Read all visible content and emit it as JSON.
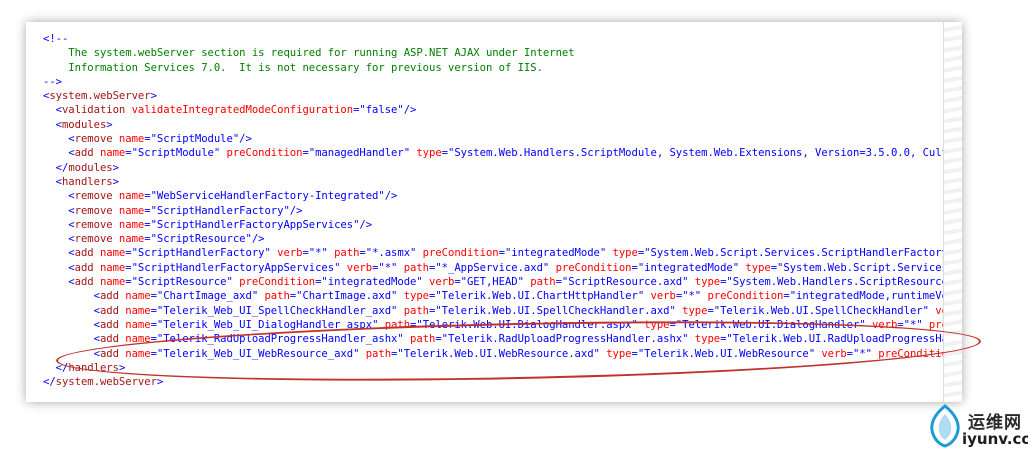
{
  "lines": [
    [
      {
        "c": "b",
        "t": "<!--"
      }
    ],
    [
      {
        "c": "c",
        "t": "    The system.webServer section is required for running ASP.NET AJAX under Internet"
      }
    ],
    [
      {
        "c": "c",
        "t": "    Information Services 7.0.  It is not necessary for previous version of IIS."
      }
    ],
    [
      {
        "c": "b",
        "t": "-->"
      }
    ],
    [
      {
        "c": "b",
        "t": "<"
      },
      {
        "c": "t",
        "t": "system.webServer"
      },
      {
        "c": "b",
        "t": ">"
      }
    ],
    [
      {
        "c": "b",
        "t": "  <"
      },
      {
        "c": "t",
        "t": "validation"
      },
      {
        "c": "a",
        "t": " validateIntegratedModeConfiguration"
      },
      {
        "c": "b",
        "t": "=\""
      },
      {
        "c": "v",
        "t": "false"
      },
      {
        "c": "b",
        "t": "\"/>"
      }
    ],
    [
      {
        "c": "b",
        "t": "  <"
      },
      {
        "c": "t",
        "t": "modules"
      },
      {
        "c": "b",
        "t": ">"
      }
    ],
    [
      {
        "c": "b",
        "t": "    <"
      },
      {
        "c": "t",
        "t": "remove"
      },
      {
        "c": "a",
        "t": " name"
      },
      {
        "c": "b",
        "t": "=\""
      },
      {
        "c": "v",
        "t": "ScriptModule"
      },
      {
        "c": "b",
        "t": "\"/>"
      }
    ],
    [
      {
        "c": "b",
        "t": "    <"
      },
      {
        "c": "t",
        "t": "add"
      },
      {
        "c": "a",
        "t": " name"
      },
      {
        "c": "b",
        "t": "=\""
      },
      {
        "c": "v",
        "t": "ScriptModule"
      },
      {
        "c": "b",
        "t": "\""
      },
      {
        "c": "a",
        "t": " preCondition"
      },
      {
        "c": "b",
        "t": "=\""
      },
      {
        "c": "v",
        "t": "managedHandler"
      },
      {
        "c": "b",
        "t": "\""
      },
      {
        "c": "a",
        "t": " type"
      },
      {
        "c": "b",
        "t": "=\""
      },
      {
        "c": "v",
        "t": "System.Web.Handlers.ScriptModule, System.Web.Extensions, Version=3.5.0.0, Culture"
      }
    ],
    [
      {
        "c": "b",
        "t": "  </"
      },
      {
        "c": "t",
        "t": "modules"
      },
      {
        "c": "b",
        "t": ">"
      }
    ],
    [
      {
        "c": "b",
        "t": "  <"
      },
      {
        "c": "t",
        "t": "handlers"
      },
      {
        "c": "b",
        "t": ">"
      }
    ],
    [
      {
        "c": "b",
        "t": "    <"
      },
      {
        "c": "t",
        "t": "remove"
      },
      {
        "c": "a",
        "t": " name"
      },
      {
        "c": "b",
        "t": "=\""
      },
      {
        "c": "v",
        "t": "WebServiceHandlerFactory-Integrated"
      },
      {
        "c": "b",
        "t": "\"/>"
      }
    ],
    [
      {
        "c": "b",
        "t": "    <"
      },
      {
        "c": "t",
        "t": "remove"
      },
      {
        "c": "a",
        "t": " name"
      },
      {
        "c": "b",
        "t": "=\""
      },
      {
        "c": "v",
        "t": "ScriptHandlerFactory"
      },
      {
        "c": "b",
        "t": "\"/>"
      }
    ],
    [
      {
        "c": "b",
        "t": "    <"
      },
      {
        "c": "t",
        "t": "remove"
      },
      {
        "c": "a",
        "t": " name"
      },
      {
        "c": "b",
        "t": "=\""
      },
      {
        "c": "v",
        "t": "ScriptHandlerFactoryAppServices"
      },
      {
        "c": "b",
        "t": "\"/>"
      }
    ],
    [
      {
        "c": "b",
        "t": "    <"
      },
      {
        "c": "t",
        "t": "remove"
      },
      {
        "c": "a",
        "t": " name"
      },
      {
        "c": "b",
        "t": "=\""
      },
      {
        "c": "v",
        "t": "ScriptResource"
      },
      {
        "c": "b",
        "t": "\"/>"
      }
    ],
    [
      {
        "c": "b",
        "t": "    <"
      },
      {
        "c": "t",
        "t": "add"
      },
      {
        "c": "a",
        "t": " name"
      },
      {
        "c": "b",
        "t": "=\""
      },
      {
        "c": "v",
        "t": "ScriptHandlerFactory"
      },
      {
        "c": "b",
        "t": "\""
      },
      {
        "c": "a",
        "t": " verb"
      },
      {
        "c": "b",
        "t": "=\""
      },
      {
        "c": "v",
        "t": "*"
      },
      {
        "c": "b",
        "t": "\""
      },
      {
        "c": "a",
        "t": " path"
      },
      {
        "c": "b",
        "t": "=\""
      },
      {
        "c": "v",
        "t": "*.asmx"
      },
      {
        "c": "b",
        "t": "\""
      },
      {
        "c": "a",
        "t": " preCondition"
      },
      {
        "c": "b",
        "t": "=\""
      },
      {
        "c": "v",
        "t": "integratedMode"
      },
      {
        "c": "b",
        "t": "\""
      },
      {
        "c": "a",
        "t": " type"
      },
      {
        "c": "b",
        "t": "=\""
      },
      {
        "c": "v",
        "t": "System.Web.Script.Services.ScriptHandlerFactory, S"
      }
    ],
    [
      {
        "c": "b",
        "t": "    <"
      },
      {
        "c": "t",
        "t": "add"
      },
      {
        "c": "a",
        "t": " name"
      },
      {
        "c": "b",
        "t": "=\""
      },
      {
        "c": "v",
        "t": "ScriptHandlerFactoryAppServices"
      },
      {
        "c": "b",
        "t": "\""
      },
      {
        "c": "a",
        "t": " verb"
      },
      {
        "c": "b",
        "t": "=\""
      },
      {
        "c": "v",
        "t": "*"
      },
      {
        "c": "b",
        "t": "\""
      },
      {
        "c": "a",
        "t": " path"
      },
      {
        "c": "b",
        "t": "=\""
      },
      {
        "c": "v",
        "t": "*_AppService.axd"
      },
      {
        "c": "b",
        "t": "\""
      },
      {
        "c": "a",
        "t": " preCondition"
      },
      {
        "c": "b",
        "t": "=\""
      },
      {
        "c": "v",
        "t": "integratedMode"
      },
      {
        "c": "b",
        "t": "\""
      },
      {
        "c": "a",
        "t": " type"
      },
      {
        "c": "b",
        "t": "=\""
      },
      {
        "c": "v",
        "t": "System.Web.Script.Services.Sc"
      }
    ],
    [
      {
        "c": "b",
        "t": "    <"
      },
      {
        "c": "t",
        "t": "add"
      },
      {
        "c": "a",
        "t": " name"
      },
      {
        "c": "b",
        "t": "=\""
      },
      {
        "c": "v",
        "t": "ScriptResource"
      },
      {
        "c": "b",
        "t": "\""
      },
      {
        "c": "a",
        "t": " preCondition"
      },
      {
        "c": "b",
        "t": "=\""
      },
      {
        "c": "v",
        "t": "integratedMode"
      },
      {
        "c": "b",
        "t": "\""
      },
      {
        "c": "a",
        "t": " verb"
      },
      {
        "c": "b",
        "t": "=\""
      },
      {
        "c": "v",
        "t": "GET,HEAD"
      },
      {
        "c": "b",
        "t": "\""
      },
      {
        "c": "a",
        "t": " path"
      },
      {
        "c": "b",
        "t": "=\""
      },
      {
        "c": "v",
        "t": "ScriptResource.axd"
      },
      {
        "c": "b",
        "t": "\""
      },
      {
        "c": "a",
        "t": " type"
      },
      {
        "c": "b",
        "t": "=\""
      },
      {
        "c": "v",
        "t": "System.Web.Handlers.ScriptResourceHan"
      }
    ],
    [
      {
        "c": "b",
        "t": "        <"
      },
      {
        "c": "t",
        "t": "add"
      },
      {
        "c": "a",
        "t": " name"
      },
      {
        "c": "b",
        "t": "=\""
      },
      {
        "c": "v",
        "t": "ChartImage_axd"
      },
      {
        "c": "b",
        "t": "\""
      },
      {
        "c": "a",
        "t": " path"
      },
      {
        "c": "b",
        "t": "=\""
      },
      {
        "c": "v",
        "t": "ChartImage.axd"
      },
      {
        "c": "b",
        "t": "\""
      },
      {
        "c": "a",
        "t": " type"
      },
      {
        "c": "b",
        "t": "=\""
      },
      {
        "c": "v",
        "t": "Telerik.Web.UI.ChartHttpHandler"
      },
      {
        "c": "b",
        "t": "\""
      },
      {
        "c": "a",
        "t": " verb"
      },
      {
        "c": "b",
        "t": "=\""
      },
      {
        "c": "v",
        "t": "*"
      },
      {
        "c": "b",
        "t": "\""
      },
      {
        "c": "a",
        "t": " preCondition"
      },
      {
        "c": "b",
        "t": "=\""
      },
      {
        "c": "v",
        "t": "integratedMode,runtimeVersi"
      }
    ],
    [
      {
        "c": "b",
        "t": "        <"
      },
      {
        "c": "t",
        "t": "add"
      },
      {
        "c": "a",
        "t": " name"
      },
      {
        "c": "b",
        "t": "=\""
      },
      {
        "c": "v",
        "t": "Telerik_Web_UI_SpellCheckHandler_axd"
      },
      {
        "c": "b",
        "t": "\""
      },
      {
        "c": "a",
        "t": " path"
      },
      {
        "c": "b",
        "t": "=\""
      },
      {
        "c": "v",
        "t": "Telerik.Web.UI.SpellCheckHandler.axd"
      },
      {
        "c": "b",
        "t": "\""
      },
      {
        "c": "a",
        "t": " type"
      },
      {
        "c": "b",
        "t": "=\""
      },
      {
        "c": "v",
        "t": "Telerik.Web.UI.SpellCheckHandler"
      },
      {
        "c": "b",
        "t": "\""
      },
      {
        "c": "a",
        "t": " verb"
      },
      {
        "c": "b",
        "t": "="
      }
    ],
    [
      {
        "c": "b",
        "t": "        <"
      },
      {
        "c": "t",
        "t": "add"
      },
      {
        "c": "a",
        "t": " name"
      },
      {
        "c": "b",
        "t": "=\""
      },
      {
        "c": "v",
        "t": "Telerik_Web_UI_DialogHandler_aspx"
      },
      {
        "c": "b",
        "t": "\""
      },
      {
        "c": "a",
        "t": " path"
      },
      {
        "c": "b",
        "t": "=\""
      },
      {
        "c": "v",
        "t": "Telerik.Web.UI.DialogHandler.aspx"
      },
      {
        "c": "b",
        "t": "\""
      },
      {
        "c": "a",
        "t": " type"
      },
      {
        "c": "b",
        "t": "=\""
      },
      {
        "c": "v",
        "t": "Telerik.Web.UI.DialogHandler"
      },
      {
        "c": "b",
        "t": "\""
      },
      {
        "c": "a",
        "t": " verb"
      },
      {
        "c": "b",
        "t": "=\""
      },
      {
        "c": "v",
        "t": "*"
      },
      {
        "c": "b",
        "t": "\""
      },
      {
        "c": "a",
        "t": " preCon"
      }
    ],
    [
      {
        "c": "b",
        "t": "        <"
      },
      {
        "c": "t",
        "t": "add"
      },
      {
        "c": "a",
        "t": " name"
      },
      {
        "c": "b",
        "t": "=\""
      },
      {
        "c": "v",
        "t": "Telerik_RadUploadProgressHandler_ashx"
      },
      {
        "c": "b",
        "t": "\""
      },
      {
        "c": "a",
        "t": " path"
      },
      {
        "c": "b",
        "t": "=\""
      },
      {
        "c": "v",
        "t": "Telerik.RadUploadProgressHandler.ashx"
      },
      {
        "c": "b",
        "t": "\""
      },
      {
        "c": "a",
        "t": " type"
      },
      {
        "c": "b",
        "t": "=\""
      },
      {
        "c": "v",
        "t": "Telerik.Web.UI.RadUploadProgressHandl"
      }
    ],
    [
      {
        "c": "b",
        "t": "        <"
      },
      {
        "c": "t",
        "t": "add"
      },
      {
        "c": "a",
        "t": " name"
      },
      {
        "c": "b",
        "t": "=\""
      },
      {
        "c": "v",
        "t": "Telerik_Web_UI_WebResource_axd"
      },
      {
        "c": "b",
        "t": "\""
      },
      {
        "c": "a",
        "t": " path"
      },
      {
        "c": "b",
        "t": "=\""
      },
      {
        "c": "v",
        "t": "Telerik.Web.UI.WebResource.axd"
      },
      {
        "c": "b",
        "t": "\""
      },
      {
        "c": "a",
        "t": " type"
      },
      {
        "c": "b",
        "t": "=\""
      },
      {
        "c": "v",
        "t": "Telerik.Web.UI.WebResource"
      },
      {
        "c": "b",
        "t": "\""
      },
      {
        "c": "a",
        "t": " verb"
      },
      {
        "c": "b",
        "t": "=\""
      },
      {
        "c": "v",
        "t": "*"
      },
      {
        "c": "b",
        "t": "\""
      },
      {
        "c": "a",
        "t": " preCondition"
      },
      {
        "c": "b",
        "t": "="
      }
    ],
    [
      {
        "c": "b",
        "t": "  </"
      },
      {
        "c": "t",
        "t": "handlers"
      },
      {
        "c": "b",
        "t": ">"
      }
    ],
    [
      {
        "c": "b",
        "t": "</"
      },
      {
        "c": "t",
        "t": "system.webServer"
      },
      {
        "c": "b",
        "t": ">"
      }
    ]
  ],
  "watermark": {
    "name_cn": "运维网",
    "url": "iyunv.com"
  }
}
